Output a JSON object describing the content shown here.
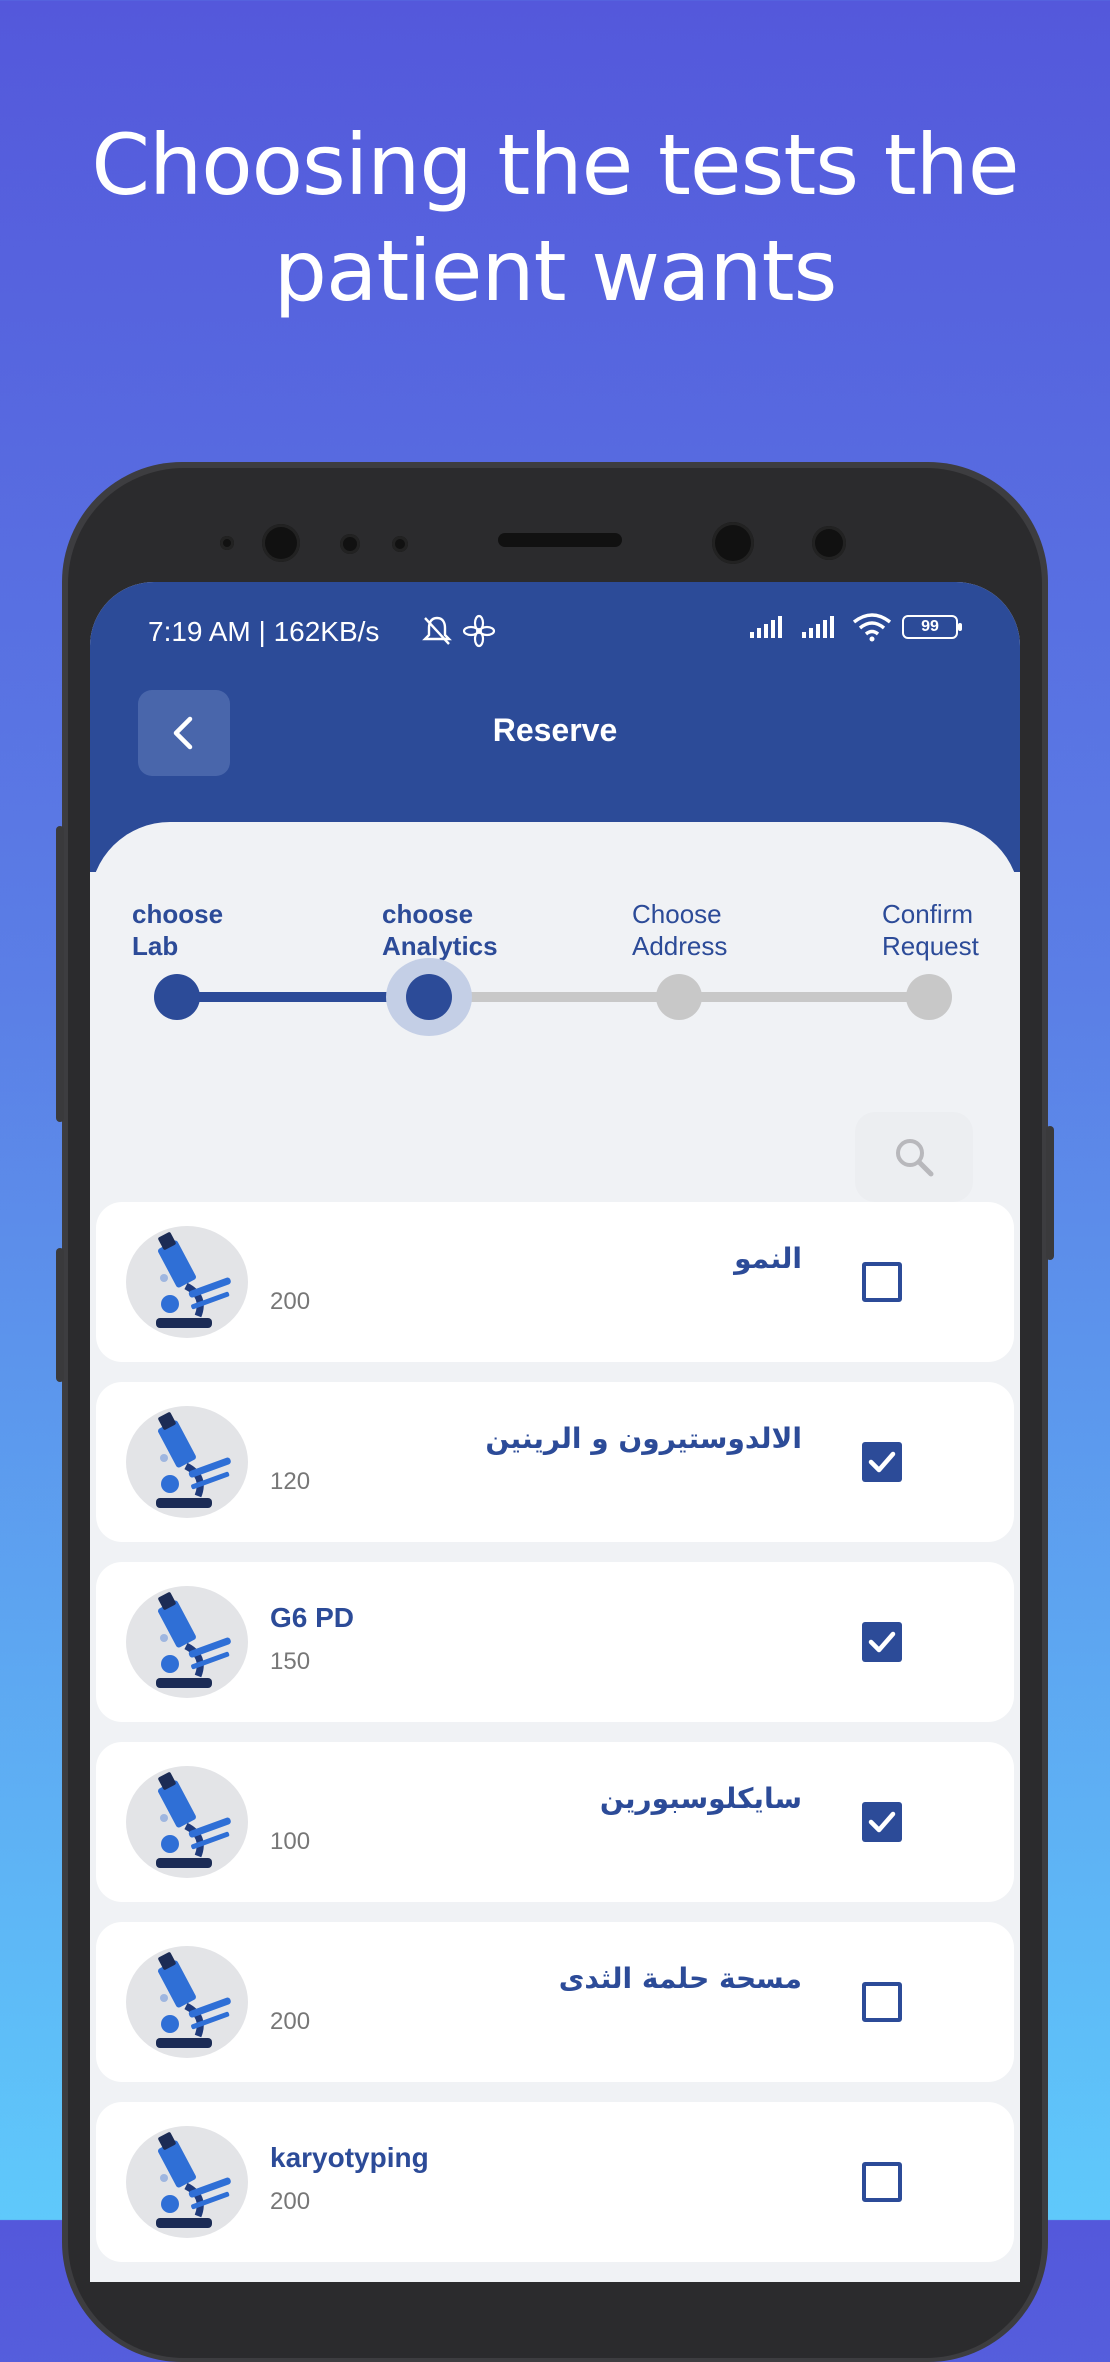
{
  "headline": {
    "line1": "Choosing the tests the",
    "line2": "patient wants"
  },
  "status_bar": {
    "time_speed": "7:19 AM | 162KB/s",
    "battery": "99",
    "icons": [
      "mute-icon",
      "fan-icon",
      "signal-icon",
      "signal-icon",
      "wifi-icon",
      "battery-icon"
    ]
  },
  "app_bar": {
    "title": "Reserve",
    "back_icon": "chevron-left-icon"
  },
  "steps": [
    {
      "line1": "choose",
      "line2": "Lab",
      "state": "done"
    },
    {
      "line1": "choose",
      "line2": "Analytics",
      "state": "current"
    },
    {
      "line1": "Choose",
      "line2": "Address",
      "state": "pending"
    },
    {
      "line1": "Confirm",
      "line2": "Request",
      "state": "pending"
    }
  ],
  "search": {
    "icon": "search-icon"
  },
  "tests": [
    {
      "name": "النمو",
      "price": "200",
      "checked": false,
      "dir": "rtl"
    },
    {
      "name": "الالدوستيرون و الرينين",
      "price": "120",
      "checked": true,
      "dir": "rtl"
    },
    {
      "name": "G6 PD",
      "price": "150",
      "checked": true,
      "dir": "ltr"
    },
    {
      "name": "سايكلوسبورين",
      "price": "100",
      "checked": true,
      "dir": "rtl"
    },
    {
      "name": "مسحة حلمة الثدى",
      "price": "200",
      "checked": false,
      "dir": "rtl"
    },
    {
      "name": "karyotyping",
      "price": "200",
      "checked": false,
      "dir": "ltr"
    }
  ],
  "colors": {
    "primary": "#2c4b98",
    "inactive": "#c8c8c8",
    "background_top": "#5458db",
    "background_bottom": "#5fc9fb"
  }
}
